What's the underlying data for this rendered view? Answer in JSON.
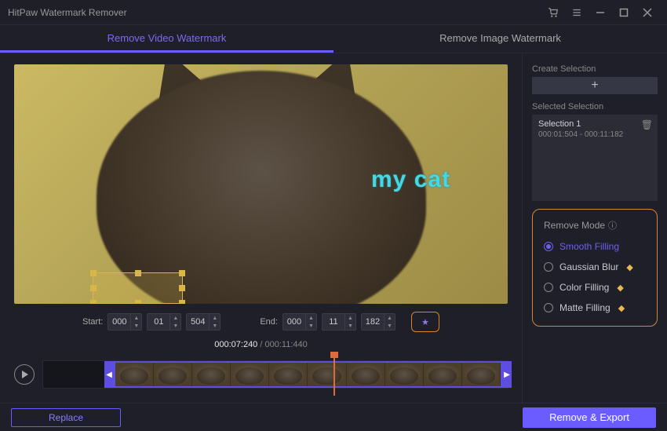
{
  "titlebar": {
    "title": "HitPaw Watermark Remover"
  },
  "tabs": {
    "video": "Remove Video Watermark",
    "image": "Remove Image Watermark"
  },
  "watermark_text": "my cat",
  "timebar": {
    "start_label": "Start:",
    "end_label": "End:",
    "start": {
      "h": "000",
      "m": "01",
      "ms": "504"
    },
    "end": {
      "h": "000",
      "m": "11",
      "ms": "182"
    }
  },
  "timecode": {
    "current": "000:07:240",
    "sep": " / ",
    "total": "000:11:440"
  },
  "sidebar": {
    "create_label": "Create Selection",
    "selected_label": "Selected Selection",
    "selection": {
      "name": "Selection 1",
      "range": "000:01:504 - 000:11:182"
    },
    "mode_header": "Remove Mode",
    "modes": {
      "smooth": "Smooth Filling",
      "gaussian": "Gaussian Blur",
      "color": "Color Filling",
      "matte": "Matte Filling"
    }
  },
  "footer": {
    "replace": "Replace",
    "export": "Remove & Export"
  }
}
